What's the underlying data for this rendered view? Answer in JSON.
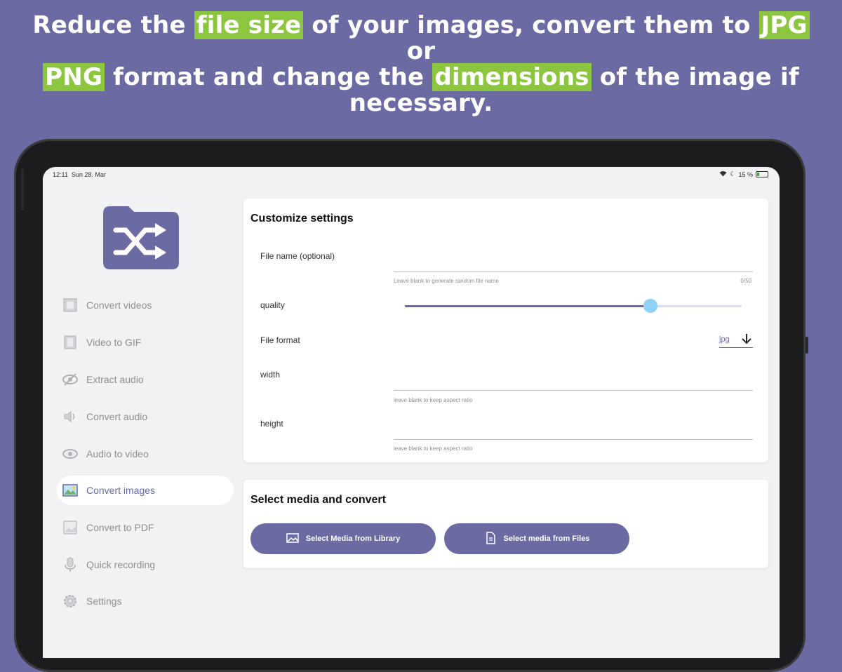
{
  "headline": {
    "part1": "Reduce the",
    "hl1": "file size",
    "part2": "of your images, convert them to",
    "hl2": "JPG",
    "part3": "or",
    "hl3": "PNG",
    "part4": "format and change the",
    "hl4": "dimensions",
    "part5": "of the image if necessary."
  },
  "status": {
    "time": "12:11",
    "date": "Sun 28. Mar",
    "battery": "15 %"
  },
  "sidebar": {
    "items": [
      {
        "label": "Convert videos",
        "icon": "film-icon"
      },
      {
        "label": "Video to GIF",
        "icon": "film-strip-icon"
      },
      {
        "label": "Extract audio",
        "icon": "eye-slash-icon"
      },
      {
        "label": "Convert audio",
        "icon": "speaker-icon"
      },
      {
        "label": "Audio to video",
        "icon": "eye-icon"
      },
      {
        "label": "Convert images",
        "icon": "image-icon"
      },
      {
        "label": "Convert to PDF",
        "icon": "picture-icon"
      },
      {
        "label": "Quick recording",
        "icon": "microphone-icon"
      },
      {
        "label": "Settings",
        "icon": "gear-icon"
      }
    ],
    "active_index": 5
  },
  "settings_card": {
    "title": "Customize settings",
    "file_name": {
      "label": "File name (optional)",
      "value": "",
      "hint": "Leave blank to generate random file name",
      "counter": "0/50"
    },
    "quality": {
      "label": "quality",
      "level": 0.73
    },
    "file_format": {
      "label": "File format",
      "value": "jpg"
    },
    "width": {
      "label": "width",
      "value": "",
      "hint": "leave blank to keep aspect ratio"
    },
    "height": {
      "label": "height",
      "value": "",
      "hint": "leave blank to keep aspect ratio"
    }
  },
  "media_card": {
    "title": "Select media and convert",
    "library_button": "Select Media from Library",
    "files_button": "Select media from Files"
  },
  "colors": {
    "background": "#6b6aa2",
    "accent": "#6867a3",
    "highlight": "#8cc63f",
    "slider_thumb": "#8fd0f5"
  }
}
